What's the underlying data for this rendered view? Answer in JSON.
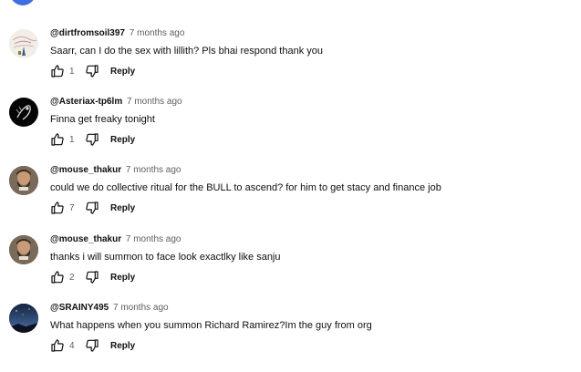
{
  "comments": [
    {
      "author": "@dirtfromsoil397",
      "time": "7 months ago",
      "text": "Saarr, can I do the sex with lillith? Pls bhai respond thank you",
      "likes": "1",
      "reply": "Reply",
      "avatar_icon": "sketch-avatar"
    },
    {
      "author": "@Asteriax-tp6lm",
      "time": "7 months ago",
      "text": "Finna get freaky tonight",
      "likes": "1",
      "reply": "Reply",
      "avatar_icon": "dark-art-avatar"
    },
    {
      "author": "@mouse_thakur",
      "time": "7 months ago",
      "text": "could we do collective ritual for the BULL to ascend? for him to get stacy and finance job",
      "likes": "7",
      "reply": "Reply",
      "avatar_icon": "bearded-man-avatar"
    },
    {
      "author": "@mouse_thakur",
      "time": "7 months ago",
      "text": "thanks i will summon to face look exactlky like sanju",
      "likes": "2",
      "reply": "Reply",
      "avatar_icon": "bearded-man-avatar"
    },
    {
      "author": "@SRAINY495",
      "time": "7 months ago",
      "text": "What happens when you summon Richard Ramirez?Im the guy from org",
      "likes": "4",
      "reply": "Reply",
      "avatar_icon": "night-sky-avatar"
    }
  ],
  "icons": {
    "like": "thumbs-up-icon",
    "dislike": "thumbs-down-icon"
  },
  "colors": {
    "text": "#0f0f0f",
    "secondary": "#606060",
    "top_avatar": "#3d6fe0"
  }
}
